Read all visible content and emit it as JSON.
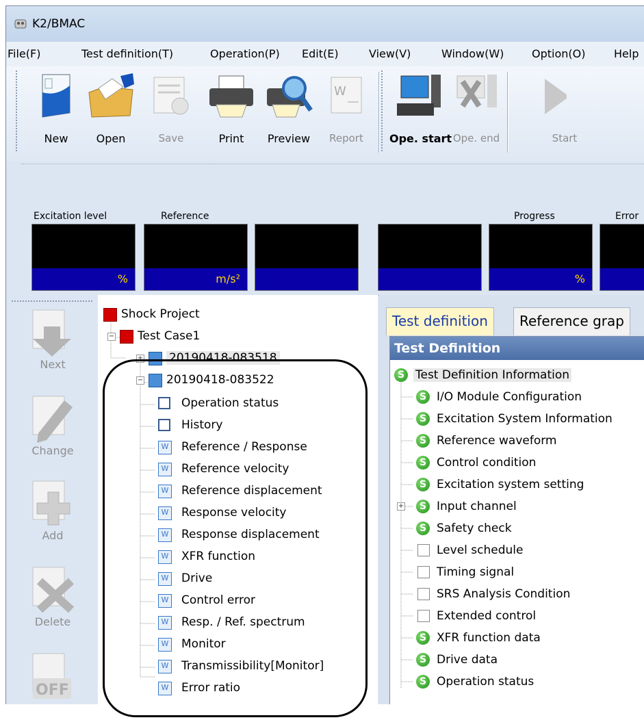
{
  "window": {
    "title": "K2/BMAC"
  },
  "menu": [
    "File(F)",
    "Test definition(T)",
    "Operation(P)",
    "Edit(E)",
    "View(V)",
    "Window(W)",
    "Option(O)",
    "Help"
  ],
  "toolbar": {
    "new": "New",
    "open": "Open",
    "save": "Save",
    "print": "Print",
    "preview": "Preview",
    "report": "Report",
    "ope_start": "Ope. start",
    "ope_end": "Ope. end",
    "start": "Start"
  },
  "levels": {
    "excitation_level": "Excitation level",
    "reference": "Reference",
    "progress": "Progress",
    "error": "Error",
    "unit_percent": "%",
    "unit_accel": "m/s²",
    "unit_percent2": "%"
  },
  "sidebar": {
    "next": "Next",
    "change": "Change",
    "add": "Add",
    "delete": "Delete",
    "off": "OFF"
  },
  "tree": {
    "project": "Shock Project",
    "testcase": "Test Case1",
    "run1": "20190418-083518",
    "run2": "20190418-083522",
    "items": [
      "Operation status",
      "History",
      "Reference / Response",
      "Reference velocity",
      "Reference displacement",
      "Response velocity",
      "Response displacement",
      "XFR function",
      "Drive",
      "Control error",
      "Resp. / Ref. spectrum",
      "Monitor",
      "Transmissibility[Monitor]",
      "Error ratio"
    ]
  },
  "tabs": {
    "test_definition": "Test definition",
    "reference_graph": "Reference grap"
  },
  "definition": {
    "header": "Test Definition",
    "root": "Test Definition Information",
    "items": [
      {
        "label": "I/O Module Configuration",
        "state": "set"
      },
      {
        "label": "Excitation System Information",
        "state": "set"
      },
      {
        "label": "Reference waveform",
        "state": "set"
      },
      {
        "label": "Control condition",
        "state": "set"
      },
      {
        "label": "Excitation system setting",
        "state": "set"
      },
      {
        "label": "Input channel",
        "state": "set"
      },
      {
        "label": "Safety check",
        "state": "set"
      },
      {
        "label": "Level schedule",
        "state": "empty"
      },
      {
        "label": "Timing signal",
        "state": "empty"
      },
      {
        "label": "SRS Analysis Condition",
        "state": "empty"
      },
      {
        "label": "Extended control",
        "state": "empty"
      },
      {
        "label": "XFR function data",
        "state": "set"
      },
      {
        "label": "Drive data",
        "state": "set"
      },
      {
        "label": "Operation status",
        "state": "set"
      }
    ],
    "status_icon_letter": "S"
  }
}
